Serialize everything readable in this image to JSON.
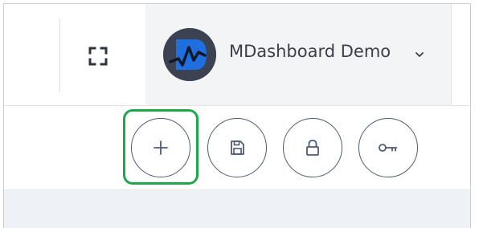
{
  "header": {
    "account_name": "MDashboard Demo",
    "icons": {
      "fullscreen": "fullscreen-icon",
      "avatar": "dashboard-logo-icon",
      "chevron": "chevron-down-icon"
    }
  },
  "toolbar": {
    "buttons": [
      {
        "icon": "plus-icon",
        "highlighted": true
      },
      {
        "icon": "save-icon",
        "highlighted": false
      },
      {
        "icon": "lock-icon",
        "highlighted": false
      },
      {
        "icon": "key-icon",
        "highlighted": false
      }
    ]
  },
  "colors": {
    "highlight": "#1ea84a",
    "button_border": "#4e5a72",
    "avatar_bg": "#3b4252",
    "avatar_accent": "#1f6fe0"
  }
}
